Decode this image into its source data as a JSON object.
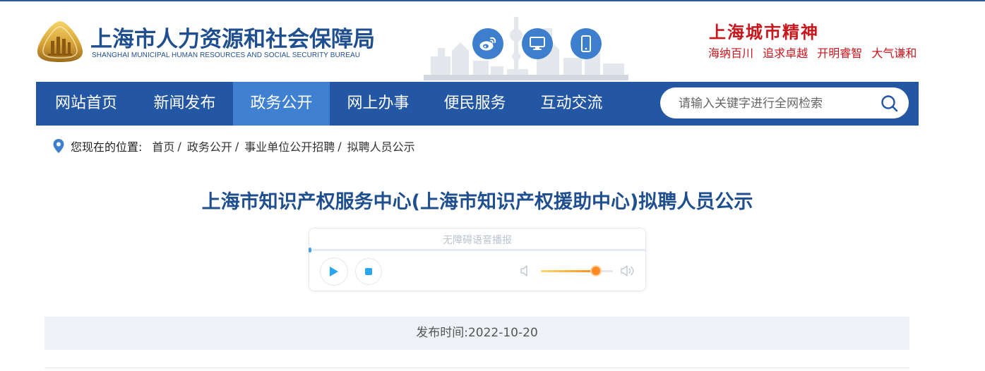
{
  "header": {
    "site_name": "上海市人力资源和社会保障局",
    "site_name_en": "SHANGHAI MUNICIPAL HUMAN RESOURCES AND SOCIAL SECURITY BUREAU",
    "social": [
      {
        "name": "weibo-icon"
      },
      {
        "name": "desktop-icon"
      },
      {
        "name": "mobile-icon"
      }
    ],
    "slogan": {
      "title": "上海城市精神",
      "items": [
        "海纳百川",
        "追求卓越",
        "开明睿智",
        "大气谦和"
      ]
    }
  },
  "nav": {
    "items": [
      {
        "label": "网站首页",
        "active": false
      },
      {
        "label": "新闻发布",
        "active": false
      },
      {
        "label": "政务公开",
        "active": true
      },
      {
        "label": "网上办事",
        "active": false
      },
      {
        "label": "便民服务",
        "active": false
      },
      {
        "label": "互动交流",
        "active": false
      }
    ],
    "search": {
      "placeholder": "请输入关键字进行全网检索",
      "value": ""
    }
  },
  "breadcrumb": {
    "label": "您现在的位置:",
    "items": [
      "首页",
      "政务公开",
      "事业单位公开招聘",
      "拟聘人员公示"
    ]
  },
  "article": {
    "title": "上海市知识产权服务中心(上海市知识产权援助中心)拟聘人员公示",
    "player": {
      "label": "无障碍语音播报",
      "progress": 0,
      "volume": 0.76
    },
    "publish_label": "发布时间:",
    "publish_date": "2022-10-20"
  },
  "colors": {
    "brand_blue": "#2356a3",
    "nav_active": "#3f80d1",
    "title_blue": "#1f4f8f",
    "slogan_red": "#c8161d",
    "volume_orange": "#ff8a1f"
  }
}
